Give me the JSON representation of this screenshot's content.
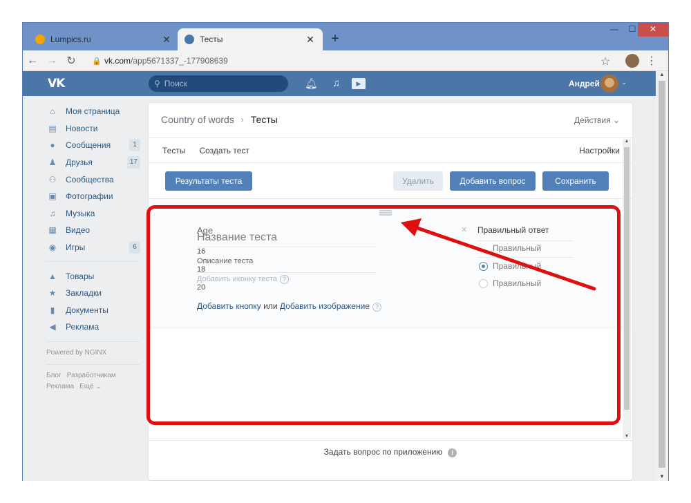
{
  "browser": {
    "tabs": [
      {
        "title": "Lumpics.ru",
        "close": "✕"
      },
      {
        "title": "Тесты",
        "close": "✕"
      }
    ],
    "new_tab": "+",
    "window_controls": {
      "min": "—",
      "max": "☐",
      "close": "✕"
    },
    "address": {
      "host": "vk.com",
      "path": "/app5671337_-177908639"
    },
    "icons": {
      "back": "back-icon",
      "forward": "forward-icon",
      "reload": "reload-icon",
      "lock": "lock-icon",
      "star": "star-icon",
      "menu": "menu-icon"
    }
  },
  "header": {
    "logo": "VK",
    "search_placeholder": "Поиск",
    "user_name": "Андрей",
    "brand_color": "#4a76a8"
  },
  "sidebar": {
    "items": [
      {
        "label": "Моя страница",
        "icon": "home-icon",
        "badge": ""
      },
      {
        "label": "Новости",
        "icon": "news-icon",
        "badge": ""
      },
      {
        "label": "Сообщения",
        "icon": "messages-icon",
        "badge": "1"
      },
      {
        "label": "Друзья",
        "icon": "friends-icon",
        "badge": "17"
      },
      {
        "label": "Сообщества",
        "icon": "groups-icon",
        "badge": ""
      },
      {
        "label": "Фотографии",
        "icon": "photos-icon",
        "badge": ""
      },
      {
        "label": "Музыка",
        "icon": "music-icon",
        "badge": ""
      },
      {
        "label": "Видео",
        "icon": "video-icon",
        "badge": ""
      },
      {
        "label": "Игры",
        "icon": "games-icon",
        "badge": "6"
      }
    ],
    "items2": [
      {
        "label": "Товары",
        "icon": "goods-icon"
      },
      {
        "label": "Закладки",
        "icon": "bookmarks-icon"
      },
      {
        "label": "Документы",
        "icon": "documents-icon"
      },
      {
        "label": "Реклама",
        "icon": "ads-icon"
      }
    ],
    "powered": "Powered by NGINX",
    "footer_links": [
      "Блог",
      "Разработчикам",
      "Реклама",
      "Ещё ⌄"
    ]
  },
  "main": {
    "breadcrumb": {
      "parent": "Country of words",
      "current": "Тесты"
    },
    "actions": "Действия ⌄",
    "tabs": [
      "Тесты",
      "Создать тест"
    ],
    "settings": "Настройки",
    "buttons": {
      "results": "Результаты теста",
      "delete": "Удалить",
      "add_question": "Добавить вопрос",
      "save": "Сохранить"
    },
    "question": {
      "ghost_age": "Age",
      "ghost_values": [
        "16",
        "18",
        "20"
      ],
      "title_placeholder": "Название теста",
      "description": "Описание теста",
      "add_icon": "Добавить иконку теста",
      "add_button": "Добавить кнопку",
      "or": "или",
      "add_image": "Добавить изображение",
      "correct_answer_header": "Правильный ответ",
      "answers": [
        {
          "label": "Правильный",
          "selected": false
        },
        {
          "label": "Правильный",
          "selected": true
        },
        {
          "label": "Правильный",
          "selected": false
        }
      ]
    },
    "footer": "Задать вопрос по приложению"
  },
  "annotation": {
    "color": "#e00f0f"
  }
}
